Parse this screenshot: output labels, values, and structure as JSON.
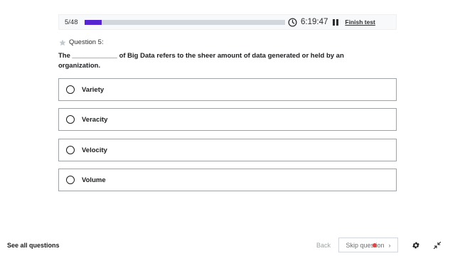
{
  "header": {
    "progress_count": "5/48",
    "progress_fraction": 0.085,
    "timer": "6:19:47",
    "finish_label": "Finish test",
    "accent_color": "#5624d0"
  },
  "question": {
    "label": "Question 5:",
    "text": "The ____________ of Big Data refers to the sheer amount of data generated or held by an organization."
  },
  "options": [
    {
      "label": "Variety"
    },
    {
      "label": "Veracity"
    },
    {
      "label": "Velocity"
    },
    {
      "label": "Volume"
    }
  ],
  "footer": {
    "see_all": "See all questions",
    "back": "Back",
    "skip": "Skip question"
  },
  "icons": [
    "clock-icon",
    "pause-icon",
    "star-icon",
    "chevron-right-icon",
    "gear-icon",
    "collapse-icon"
  ]
}
